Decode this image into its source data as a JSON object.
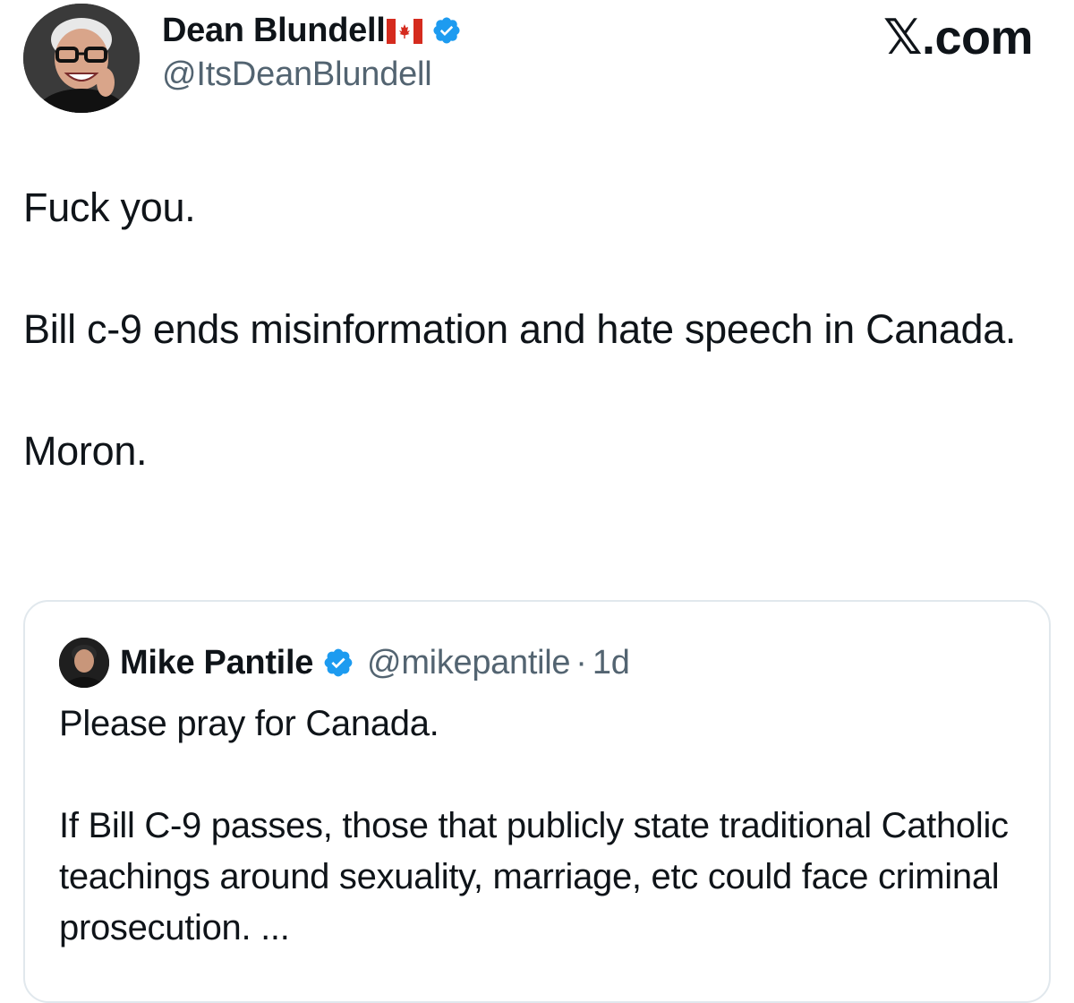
{
  "author": {
    "name": "Dean Blundell",
    "flag": "canada-flag-icon",
    "verified": "verified-badge-icon",
    "handle": "@ItsDeanBlundell"
  },
  "site_label": {
    "x": "𝕏",
    "suffix": ".com"
  },
  "tweet": {
    "line1": "Fuck you.",
    "line2": "Bill c-9 ends misinformation and hate speech in Canada.",
    "line3": "Moron."
  },
  "quoted": {
    "name": "Mike Pantile",
    "verified": "verified-badge-icon",
    "handle": "@mikepantile",
    "separator": "·",
    "time": "1d",
    "para1": "Please pray for Canada.",
    "para2": "If Bill C-9 passes, those that publicly state traditional Catholic teachings around sexuality, marriage, etc could face criminal prosecution. ..."
  },
  "colors": {
    "text_primary": "#0f1419",
    "text_secondary": "#536471",
    "verified_blue": "#1d9bf0",
    "card_border": "#e1e8ed",
    "flag_red": "#d52b1e"
  }
}
